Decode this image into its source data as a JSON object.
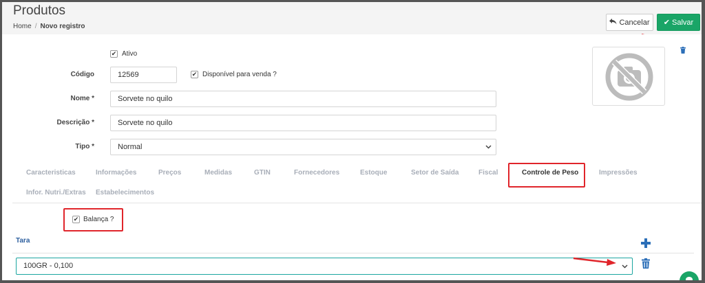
{
  "header": {
    "title": "Produtos",
    "breadcrumb": {
      "home": "Home",
      "separator": "/",
      "current": "Novo registro"
    },
    "cancel_label": "Cancelar",
    "save_label": "Salvar"
  },
  "form": {
    "ativo_label": "Ativo",
    "codigo_label": "Código",
    "codigo_value": "12569",
    "disponivel_label": "Disponível para venda ?",
    "nome_label": "Nome *",
    "nome_value": "Sorvete no quilo",
    "descricao_label": "Descrição *",
    "descricao_value": "Sorvete no quilo",
    "tipo_label": "Tipo *",
    "tipo_value": "Normal"
  },
  "tabs": [
    "Caracteristicas",
    "Informações",
    "Preços",
    "Medidas",
    "GTIN",
    "Fornecedores",
    "Estoque",
    "Setor de Saída",
    "Fiscal",
    "Controle de Peso",
    "Impressões",
    "Infor. Nutri./Extras",
    "Estabelecimentos"
  ],
  "active_tab": "Controle de Peso",
  "peso": {
    "balanca_label": "Balança ?",
    "tara_label": "Tara",
    "tara_value": "100GR - 0,100"
  },
  "colors": {
    "save": "#1aa567",
    "highlight": "#e0242a",
    "tara_title": "#2c5e9e",
    "icon_blue": "#2c6fb8"
  },
  "icons": [
    "reply-icon",
    "check-icon",
    "no-photo-icon",
    "trash-icon",
    "plus-icon",
    "chevron-down-icon",
    "chat-icon"
  ]
}
